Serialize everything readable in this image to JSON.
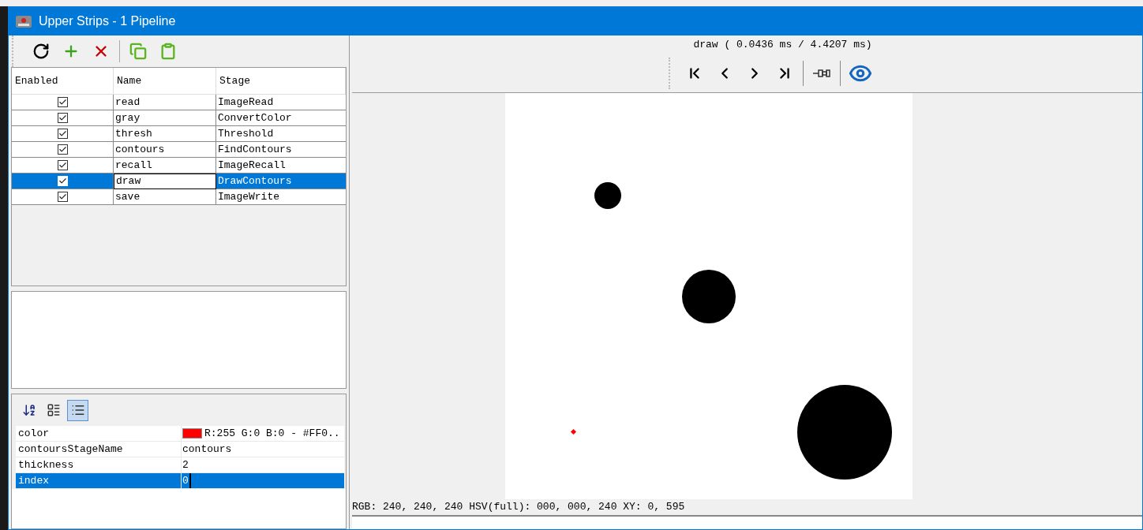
{
  "window": {
    "title": "Upper Strips - 1 Pipeline"
  },
  "toolbar": [
    {
      "kind": "refresh"
    },
    {
      "kind": "add"
    },
    {
      "kind": "delete"
    },
    {
      "kind": "copy"
    },
    {
      "kind": "paste"
    }
  ],
  "stages_table": {
    "columns": [
      "Enabled",
      "Name",
      "Stage"
    ],
    "rows": [
      {
        "enabled": true,
        "name": "read",
        "stage": "ImageRead",
        "selected": false
      },
      {
        "enabled": true,
        "name": "gray",
        "stage": "ConvertColor",
        "selected": false
      },
      {
        "enabled": true,
        "name": "thresh",
        "stage": "Threshold",
        "selected": false
      },
      {
        "enabled": true,
        "name": "contours",
        "stage": "FindContours",
        "selected": false
      },
      {
        "enabled": true,
        "name": "recall",
        "stage": "ImageRecall",
        "selected": false
      },
      {
        "enabled": true,
        "name": "draw",
        "stage": "DrawContours",
        "selected": true
      },
      {
        "enabled": true,
        "name": "save",
        "stage": "ImageWrite",
        "selected": false
      }
    ]
  },
  "property_tools": [
    {
      "kind": "sort",
      "selected": false
    },
    {
      "kind": "categories",
      "selected": false
    },
    {
      "kind": "list",
      "selected": true
    }
  ],
  "properties": [
    {
      "name": "color",
      "value": "R:255 G:0 B:0 - #FF0..",
      "color": "#ff0000",
      "selected": false
    },
    {
      "name": "contoursStageName",
      "value": "contours",
      "selected": false
    },
    {
      "name": "thickness",
      "value": "2",
      "selected": false
    },
    {
      "name": "index",
      "value": "0",
      "selected": true
    }
  ],
  "viewer": {
    "timing": "draw ( 0.0436 ms / 4.4207 ms)",
    "status": "RGB: 240, 240, 240 HSV(full): 000, 000, 240 XY: 0, 595"
  }
}
